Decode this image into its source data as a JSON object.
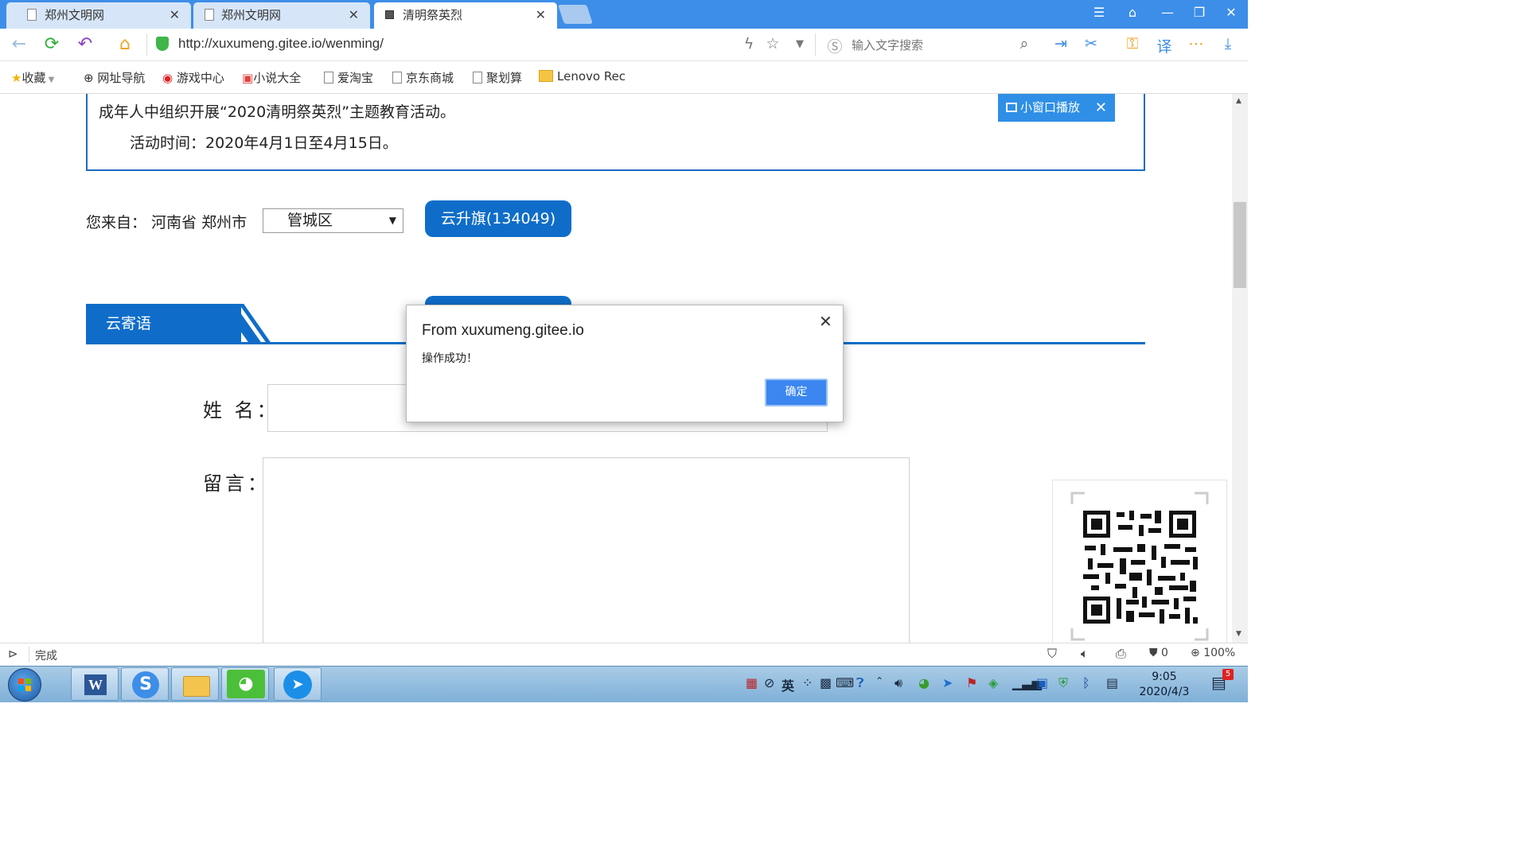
{
  "tabs": [
    {
      "label": "郑州文明网",
      "active": false
    },
    {
      "label": "郑州文明网",
      "active": false
    },
    {
      "label": "清明祭英烈",
      "active": true
    }
  ],
  "address": {
    "url": "http://xuxumeng.gitee.io/wenming/",
    "search_placeholder": "输入文字搜索"
  },
  "bookmarks": [
    "收藏",
    "网址导航",
    "游戏中心",
    "小说大全",
    "爱淘宝",
    "京东商城",
    "聚划算",
    "Lenovo Rec"
  ],
  "page": {
    "notice_line1": "成年人中组织开展“2020清明祭英烈”主题教育活动。",
    "notice_line2": "活动时间：2020年4月1日至4月15日。",
    "popout_label": "小窗口播放",
    "origin_label": "您来自： 河南省 郑州市",
    "district_value": "管城区",
    "raise_button": "云升旗(134049)",
    "section_title": "云寄语",
    "name_label": "姓 名：",
    "message_label": "留言："
  },
  "dialog": {
    "title": "From xuxumeng.gitee.io",
    "message": "操作成功！",
    "ok_label": "确定"
  },
  "statusbar": {
    "status": "完成",
    "block_count": "0",
    "zoom": "100%"
  },
  "taskbar": {
    "time": "9:05",
    "date": "2020/4/3",
    "ime": "英",
    "notification_count": "5"
  },
  "colors": {
    "tab_bar": "#3d8ee8",
    "brand_blue": "#0f6dc9",
    "dialog_button": "#3b86f0"
  }
}
